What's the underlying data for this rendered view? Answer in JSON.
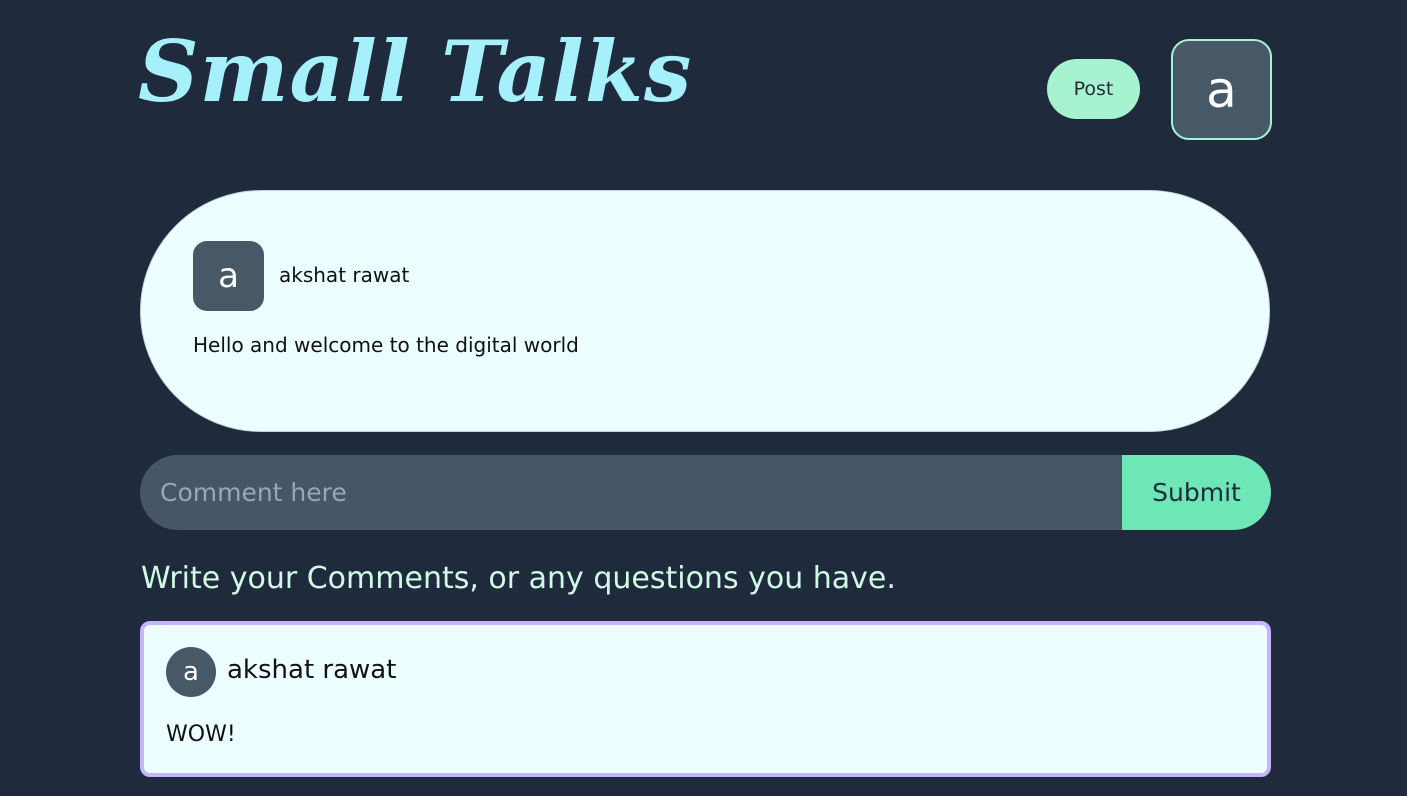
{
  "header": {
    "logo": "Small Talks",
    "post_button": "Post",
    "user_avatar": "a"
  },
  "post": {
    "avatar": "a",
    "author": "akshat rawat",
    "text": "Hello and welcome to the digital world"
  },
  "comment_form": {
    "placeholder": "Comment here",
    "value": "",
    "submit_label": "Submit"
  },
  "comments_heading": "Write your Comments, or any questions you have.",
  "comments": [
    {
      "avatar": "a",
      "author": "akshat rawat",
      "text": "WOW!"
    }
  ],
  "colors": {
    "background": "#1f2a3c",
    "logo": "#a5f0fb",
    "post_button": "#a7f3d0",
    "card": "#ecfeff",
    "avatar": "#475866",
    "input": "#475569",
    "submit": "#6ee7b7",
    "comment_border": "#c4b5fd",
    "heading": "#d1fae5"
  }
}
